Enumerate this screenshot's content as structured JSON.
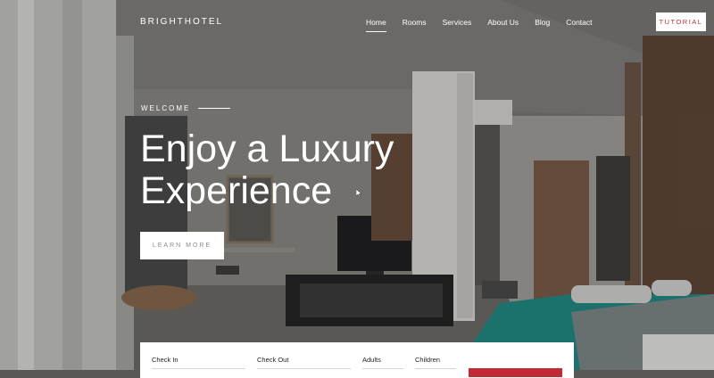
{
  "header": {
    "brand": "BRIGHTHOTEL",
    "nav": [
      "Home",
      "Rooms",
      "Services",
      "About Us",
      "Blog",
      "Contact"
    ],
    "active_nav": "Home",
    "tutorial_label": "TUTORIAL"
  },
  "hero": {
    "eyebrow": "WELCOME",
    "title_line1": "Enjoy a Luxury",
    "title_line2": "Experience",
    "cta_label": "LEARN MORE"
  },
  "booking": {
    "check_in_label": "Check In",
    "check_out_label": "Check Out",
    "adults_label": "Adults",
    "children_label": "Children"
  },
  "colors": {
    "accent": "#c12a37",
    "teal_bedding": "#1f8c86"
  }
}
